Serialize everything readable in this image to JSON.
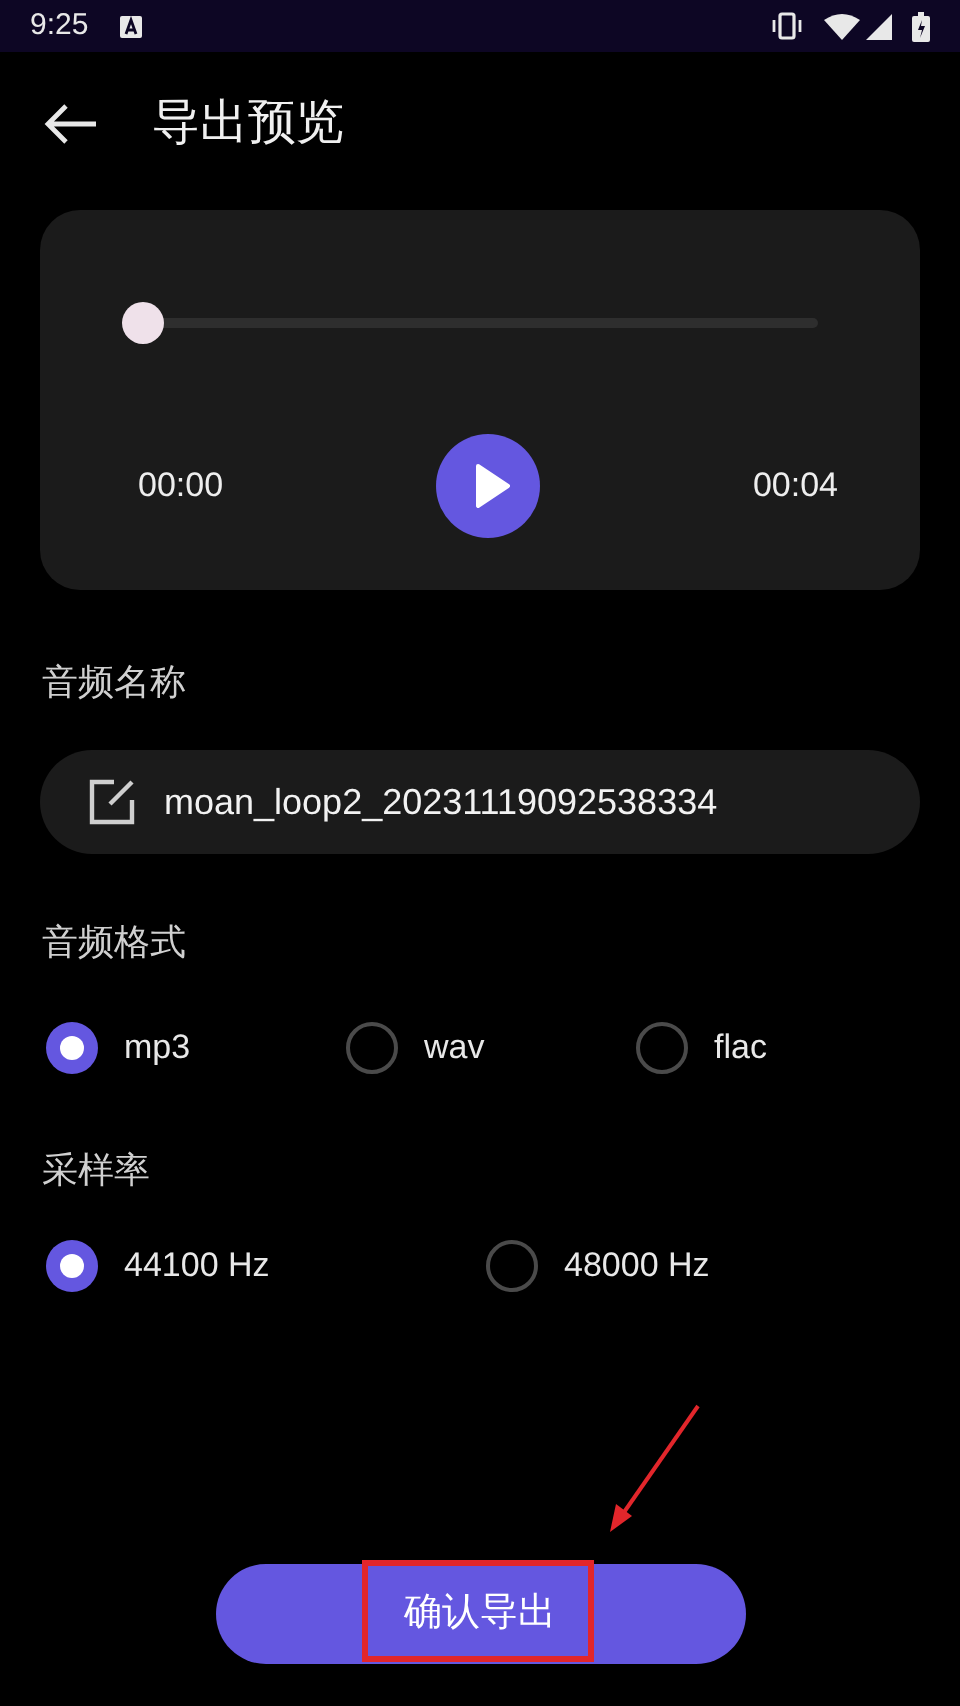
{
  "status_bar": {
    "time": "9:25"
  },
  "header": {
    "title": "导出预览"
  },
  "player": {
    "level": 0,
    "current_time": "00:00",
    "total_time": "00:04",
    "playing": false
  },
  "name_section": {
    "label": "音频名称",
    "value": "moan_loop2_20231119092538334"
  },
  "format_section": {
    "label": "音频格式",
    "options": [
      {
        "label": "mp3",
        "selected": true
      },
      {
        "label": "wav",
        "selected": false
      },
      {
        "label": "flac",
        "selected": false
      }
    ]
  },
  "rate_section": {
    "label": "采样率",
    "options": [
      {
        "label": "44100 Hz",
        "selected": true
      },
      {
        "label": "48000 Hz",
        "selected": false
      }
    ]
  },
  "confirm_button": {
    "label": "确认导出",
    "highlighted": true
  }
}
